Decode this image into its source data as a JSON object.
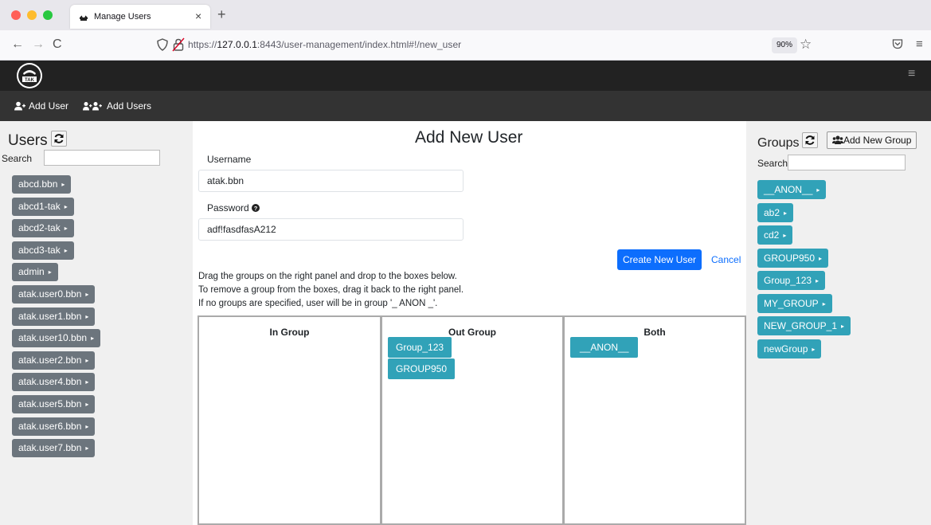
{
  "browser": {
    "tab_title": "Manage Users",
    "tab_close": "×",
    "new_tab": "+",
    "url_prefix": "https://",
    "url_host": "127.0.0.1",
    "url_rest": ":8443/user-management/index.html#!/new_user",
    "zoom": "90%",
    "back": "←",
    "forward": "→",
    "reload": "C",
    "star": "☆",
    "menu": "≡"
  },
  "appbar": {
    "menu": "≡"
  },
  "toolbar": {
    "add_user": "Add User",
    "add_users": "Add Users"
  },
  "users_panel": {
    "title": "Users",
    "search_label": "Search",
    "search_value": "",
    "users": [
      "abcd.bbn",
      "abcd1-tak",
      "abcd2-tak",
      "abcd3-tak",
      "admin",
      "atak.user0.bbn",
      "atak.user1.bbn",
      "atak.user10.bbn",
      "atak.user2.bbn",
      "atak.user4.bbn",
      "atak.user5.bbn",
      "atak.user6.bbn",
      "atak.user7.bbn"
    ]
  },
  "form": {
    "title": "Add New User",
    "username_label": "Username",
    "username_value": "atak.bbn",
    "password_label": "Password",
    "password_value": "adf!fasdfasA212",
    "create_label": "Create New User",
    "cancel_label": "Cancel",
    "instructions": [
      "Drag the groups on the right panel and drop to the boxes below.",
      "To remove a group from the boxes, drag it back to the right panel.",
      "If no groups are specified, user will be in group '_ ANON _'."
    ]
  },
  "boxes": {
    "in_group": {
      "title": "In Group",
      "items": []
    },
    "out_group": {
      "title": "Out Group",
      "items": [
        "Group_123",
        "GROUP950"
      ]
    },
    "both": {
      "title": "Both",
      "items": [
        "__ANON__"
      ]
    }
  },
  "groups_panel": {
    "title": "Groups",
    "add_label": "Add New Group",
    "search_label": "Search",
    "search_value": "",
    "groups": [
      "__ANON__",
      "ab2",
      "cd2",
      "GROUP950",
      "Group_123",
      "MY_GROUP",
      "NEW_GROUP_1",
      "newGroup"
    ]
  },
  "colors": {
    "primary": "#0d6efd",
    "group_chip": "#31a2b8",
    "user_chip": "#6c757d",
    "appbar": "#222222",
    "subbar": "#333333"
  }
}
